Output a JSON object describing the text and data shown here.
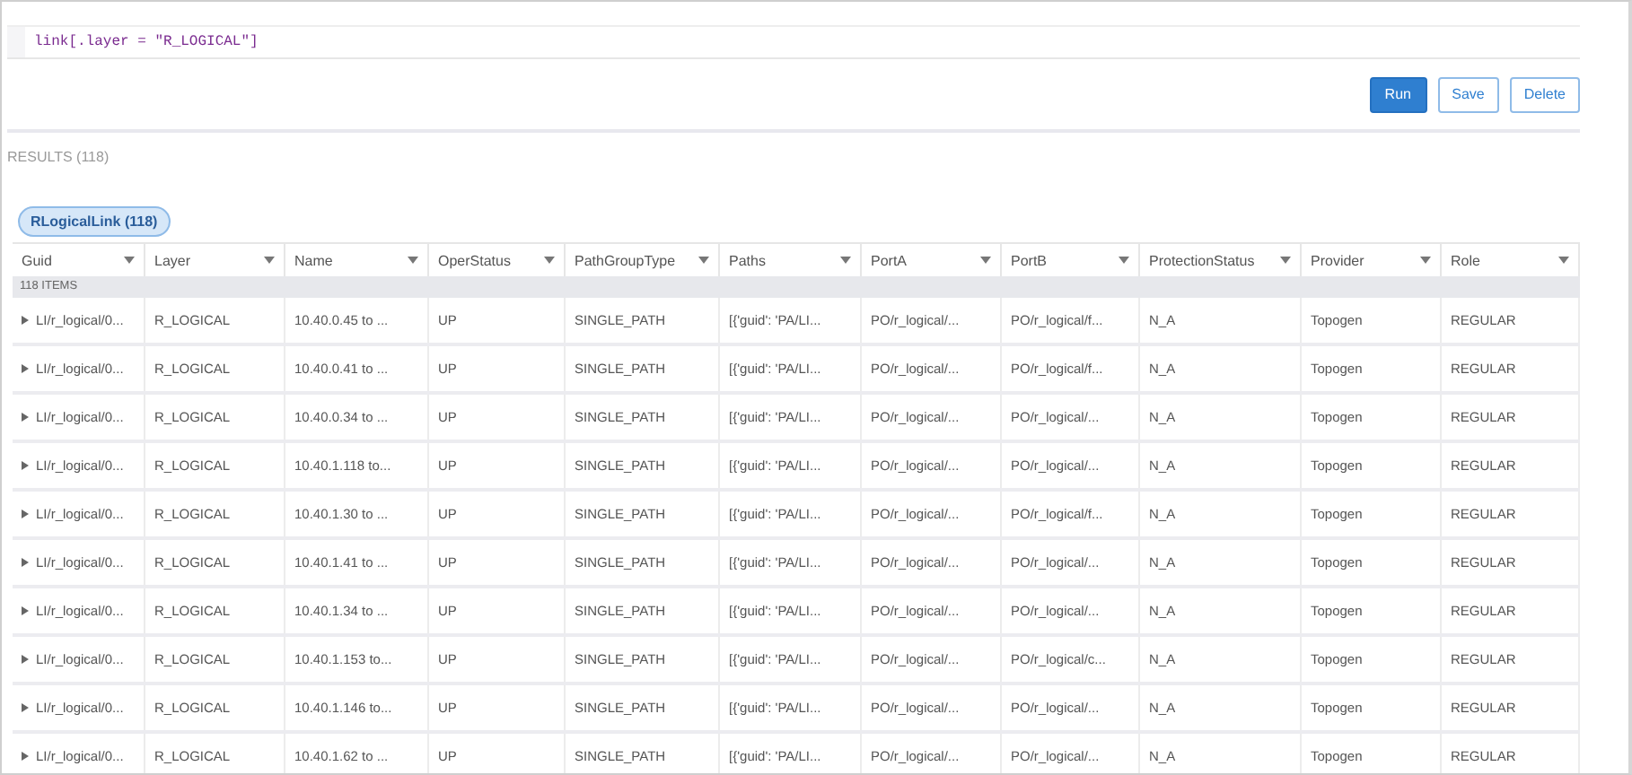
{
  "query": {
    "code": "link[.layer = \"R_LOGICAL\"]"
  },
  "buttons": [
    {
      "label": "Run",
      "kind": "primary"
    },
    {
      "label": "Save",
      "kind": "outline"
    },
    {
      "label": "Delete",
      "kind": "outline"
    }
  ],
  "results": {
    "label": "RESULTS (118)"
  },
  "result_tabs": [
    {
      "label": "RLogicalLink (118)",
      "selected": true
    }
  ],
  "table": {
    "columns": [
      "Guid",
      "Layer",
      "Name",
      "OperStatus",
      "PathGroupType",
      "Paths",
      "PortA",
      "PortB",
      "ProtectionStatus",
      "Provider",
      "Role"
    ],
    "item_count": "118 ITEMS",
    "rows": [
      [
        "LI/r_logical/0...",
        "R_LOGICAL",
        "10.40.0.45 to ...",
        "UP",
        "SINGLE_PATH",
        "[{'guid': 'PA/LI...",
        "PO/r_logical/...",
        "PO/r_logical/f...",
        "N_A",
        "Topogen",
        "REGULAR"
      ],
      [
        "LI/r_logical/0...",
        "R_LOGICAL",
        "10.40.0.41 to ...",
        "UP",
        "SINGLE_PATH",
        "[{'guid': 'PA/LI...",
        "PO/r_logical/...",
        "PO/r_logical/f...",
        "N_A",
        "Topogen",
        "REGULAR"
      ],
      [
        "LI/r_logical/0...",
        "R_LOGICAL",
        "10.40.0.34 to ...",
        "UP",
        "SINGLE_PATH",
        "[{'guid': 'PA/LI...",
        "PO/r_logical/...",
        "PO/r_logical/...",
        "N_A",
        "Topogen",
        "REGULAR"
      ],
      [
        "LI/r_logical/0...",
        "R_LOGICAL",
        "10.40.1.118 to...",
        "UP",
        "SINGLE_PATH",
        "[{'guid': 'PA/LI...",
        "PO/r_logical/...",
        "PO/r_logical/...",
        "N_A",
        "Topogen",
        "REGULAR"
      ],
      [
        "LI/r_logical/0...",
        "R_LOGICAL",
        "10.40.1.30 to ...",
        "UP",
        "SINGLE_PATH",
        "[{'guid': 'PA/LI...",
        "PO/r_logical/...",
        "PO/r_logical/f...",
        "N_A",
        "Topogen",
        "REGULAR"
      ],
      [
        "LI/r_logical/0...",
        "R_LOGICAL",
        "10.40.1.41 to ...",
        "UP",
        "SINGLE_PATH",
        "[{'guid': 'PA/LI...",
        "PO/r_logical/...",
        "PO/r_logical/...",
        "N_A",
        "Topogen",
        "REGULAR"
      ],
      [
        "LI/r_logical/0...",
        "R_LOGICAL",
        "10.40.1.34 to ...",
        "UP",
        "SINGLE_PATH",
        "[{'guid': 'PA/LI...",
        "PO/r_logical/...",
        "PO/r_logical/...",
        "N_A",
        "Topogen",
        "REGULAR"
      ],
      [
        "LI/r_logical/0...",
        "R_LOGICAL",
        "10.40.1.153 to...",
        "UP",
        "SINGLE_PATH",
        "[{'guid': 'PA/LI...",
        "PO/r_logical/...",
        "PO/r_logical/c...",
        "N_A",
        "Topogen",
        "REGULAR"
      ],
      [
        "LI/r_logical/0...",
        "R_LOGICAL",
        "10.40.1.146 to...",
        "UP",
        "SINGLE_PATH",
        "[{'guid': 'PA/LI...",
        "PO/r_logical/...",
        "PO/r_logical/...",
        "N_A",
        "Topogen",
        "REGULAR"
      ],
      [
        "LI/r_logical/0...",
        "R_LOGICAL",
        "10.40.1.62 to ...",
        "UP",
        "SINGLE_PATH",
        "[{'guid': 'PA/LI...",
        "PO/r_logical/...",
        "PO/r_logical/...",
        "N_A",
        "Topogen",
        "REGULAR"
      ]
    ]
  }
}
